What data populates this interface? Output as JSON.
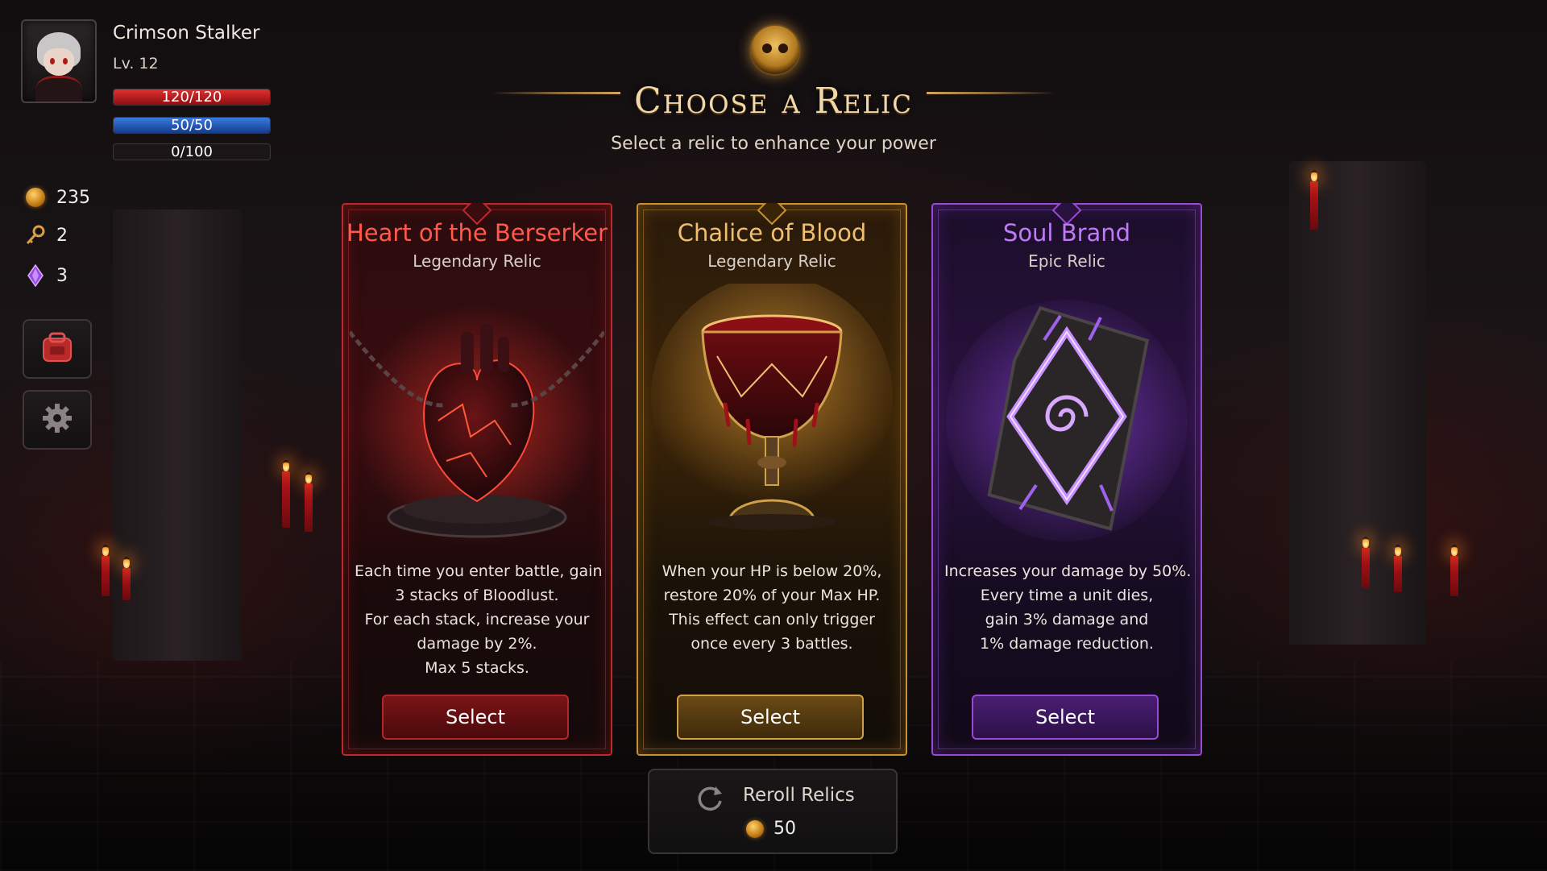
{
  "player": {
    "name": "Crimson Stalker",
    "level": "Lv. 12",
    "hp": {
      "text": "120/120",
      "fraction": 1.0
    },
    "mp": {
      "text": "50/50",
      "fraction": 1.0
    },
    "xp": {
      "text": "0/100",
      "fraction": 0.0
    }
  },
  "resources": [
    {
      "icon": "gold-coin-icon",
      "value": "235"
    },
    {
      "icon": "key-icon",
      "value": "2"
    },
    {
      "icon": "purple-crystal-icon",
      "value": "3"
    }
  ],
  "side_buttons": [
    {
      "icon": "backpack-icon"
    },
    {
      "icon": "gear-icon"
    }
  ],
  "header": {
    "title": "Choose a Relic",
    "subtitle": "Select a relic to enhance your power"
  },
  "relics": [
    {
      "name": "Heart of the Berserker",
      "rarity": "Legendary Relic",
      "art": "heart-icon",
      "description": [
        "Each time you enter battle, gain",
        "3 stacks of Bloodlust.",
        "For each stack, increase your",
        "damage by 2%.",
        "Max 5 stacks."
      ],
      "button": "Select",
      "accent": "#c0282c"
    },
    {
      "name": "Chalice of Blood",
      "rarity": "Legendary Relic",
      "art": "chalice-icon",
      "description": [
        "When your HP is below 20%,",
        "restore 20% of your Max HP.",
        "This effect can only trigger",
        "once every 3 battles."
      ],
      "button": "Select",
      "accent": "#c89030"
    },
    {
      "name": "Soul Brand",
      "rarity": "Epic Relic",
      "art": "rune-stone-icon",
      "description": [
        "Increases your damage by 50%.",
        "Every time a unit dies,",
        "gain 3% damage and",
        "1% damage reduction."
      ],
      "button": "Select",
      "accent": "#9a4ad0"
    }
  ],
  "reroll": {
    "label": "Reroll Relics",
    "cost": "50",
    "icon": "refresh-icon"
  }
}
